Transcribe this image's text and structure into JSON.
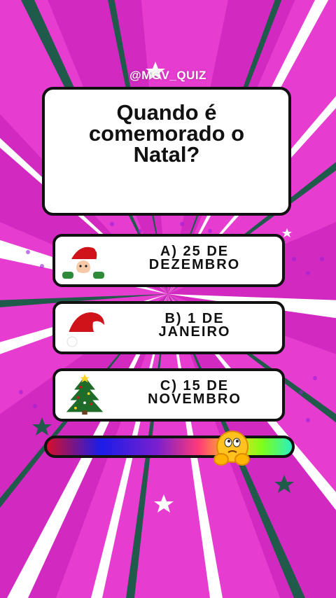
{
  "watermark": "@MGV_QUIZ",
  "question": {
    "line1": "Quando é",
    "line2": "comemorado o",
    "line3": "Natal?"
  },
  "answers": [
    {
      "line1": "A) 25 DE",
      "line2": "DEZEMBRO",
      "icon": "santa-claus-icon"
    },
    {
      "line1": "B) 1 DE",
      "line2": "JANEIRO",
      "icon": "santa-hat-icon"
    },
    {
      "line1": "C) 15 DE",
      "line2": "NOVEMBRO",
      "icon": "christmas-tree-icon"
    }
  ],
  "timer": {
    "progress": 0.75
  },
  "colors": {
    "background": "#e63cd0",
    "card": "#ffffff",
    "border": "#111111"
  }
}
